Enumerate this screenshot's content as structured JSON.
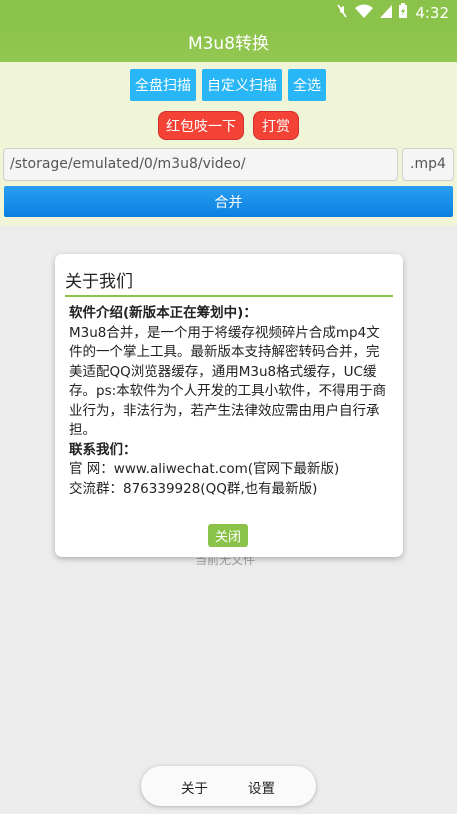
{
  "status_bar": {
    "time": "4:32",
    "icons": [
      "mute-icon",
      "wifi-icon",
      "signal-icon",
      "battery-charging-icon"
    ]
  },
  "app_bar": {
    "title": "M3u8转换"
  },
  "toolbar": {
    "scan_all_label": "全盘扫描",
    "custom_scan_label": "自定义扫描",
    "select_all_label": "全选",
    "red_packet_label": "红包吱一下",
    "tip_label": "打赏"
  },
  "path_input": {
    "value": "/storage/emulated/0/m3u8/video/"
  },
  "ext_input": {
    "value": ".mp4"
  },
  "merge_button": {
    "label": "合并"
  },
  "background_text": "当前无文件",
  "dialog": {
    "title": "关于我们",
    "intro_heading": "软件介绍(新版本正在筹划中)：",
    "intro_text": "M3u8合并，是一个用于将缓存视频碎片合成mp4文件的一个掌上工具。最新版本支持解密转码合并，完美适配QQ浏览器缓存，通用M3u8格式缓存，UC缓存。ps:本软件为个人开发的工具小软件，不得用于商业行为，非法行为，若产生法律效应需由用户自行承担。",
    "contact_heading": "联系我们：",
    "website_line": "官 网：www.aliwechat.com(官网下最新版)",
    "group_line": "交流群：876339928(QQ群,也有最新版)",
    "close_label": "关闭"
  },
  "bottom_nav": {
    "about_label": "关于",
    "settings_label": "设置"
  },
  "colors": {
    "app_bar": "#8bc34a",
    "panel_bg": "#f0f5d8",
    "blue_button": "#29b6f6",
    "red_button": "#f44336",
    "merge_button": "#0a7fe0"
  }
}
